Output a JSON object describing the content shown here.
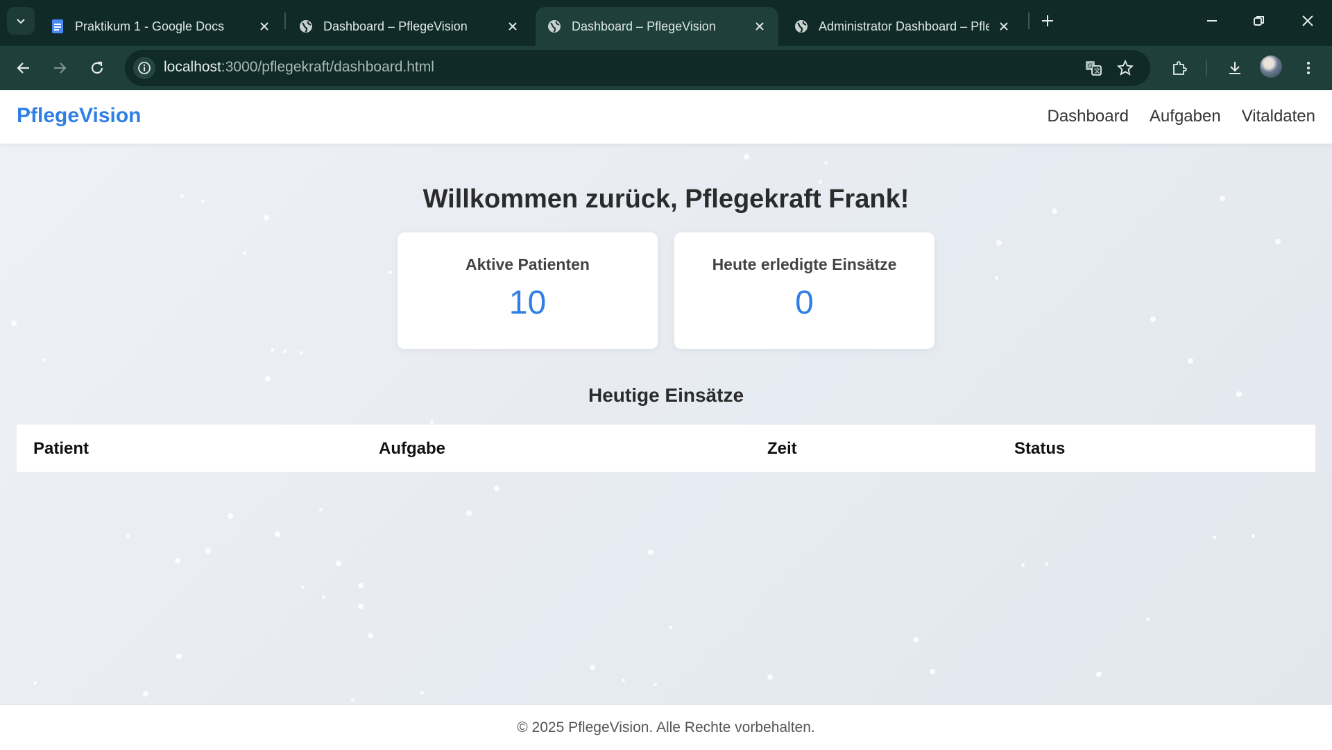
{
  "browser": {
    "tabs": [
      {
        "title": "Praktikum 1 - Google Docs",
        "favicon": "google-docs-icon"
      },
      {
        "title": "Dashboard – PflegeVision",
        "favicon": "globe-icon"
      },
      {
        "title": "Dashboard – PflegeVision",
        "favicon": "globe-icon",
        "active": true
      },
      {
        "title": "Administrator Dashboard – Pfle",
        "favicon": "globe-icon"
      }
    ],
    "url_host": "localhost",
    "url_path": ":3000/pflegekraft/dashboard.html"
  },
  "app": {
    "brand": "PflegeVision",
    "nav": [
      "Dashboard",
      "Aufgaben",
      "Vitaldaten"
    ],
    "welcome": "Willkommen zurück, Pflegekraft Frank!",
    "cards": [
      {
        "label": "Aktive Patienten",
        "value": "10"
      },
      {
        "label": "Heute erledigte Einsätze",
        "value": "0"
      }
    ],
    "section_title": "Heutige Einsätze",
    "table_headers": [
      "Patient",
      "Aufgabe",
      "Zeit",
      "Status"
    ],
    "footer": "© 2025 PflegeVision. Alle Rechte vorbehalten."
  },
  "colors": {
    "chrome_dark": "#0f2a27",
    "chrome_active": "#1e3f3a",
    "brand_blue": "#2f7fe6",
    "page_bg": "#e8ecf2"
  }
}
